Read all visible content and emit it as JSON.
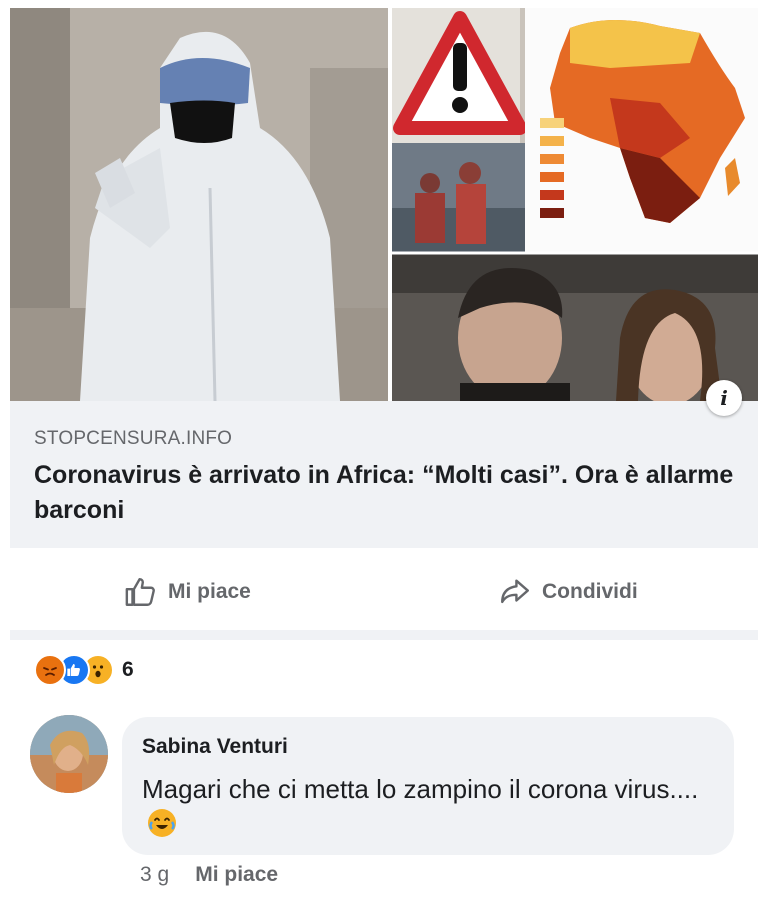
{
  "link_preview": {
    "domain": "STOPCENSURA.INFO",
    "headline": "Coronavirus è arrivato in Africa: “Molti casi”. Ora è allarme barconi",
    "info_badge": "i",
    "image_icons": [
      "hazmat-figure",
      "warning-sign-icon",
      "africa-map",
      "rescue-crew",
      "politicians"
    ]
  },
  "actions": {
    "like_label": "Mi piace",
    "like_icon": "thumbs-up-icon",
    "share_label": "Condividi",
    "share_icon": "share-arrow-icon"
  },
  "reactions": {
    "types": [
      "angry",
      "like",
      "wow"
    ],
    "count": "6"
  },
  "comment": {
    "author": "Sabina Venturi",
    "text": "Magari che ci metta lo zampino il corona virus....",
    "emoji": "laughing-tears-emoji",
    "timestamp": "3 g",
    "like_label": "Mi piace"
  },
  "colors": {
    "secondary_text": "#65676b",
    "primary_text": "#1c1e21",
    "card_background": "#f0f2f5",
    "like_blue": "#1877f2",
    "angry_orange": "#e9710f",
    "wow_yellow": "#f7b125"
  }
}
